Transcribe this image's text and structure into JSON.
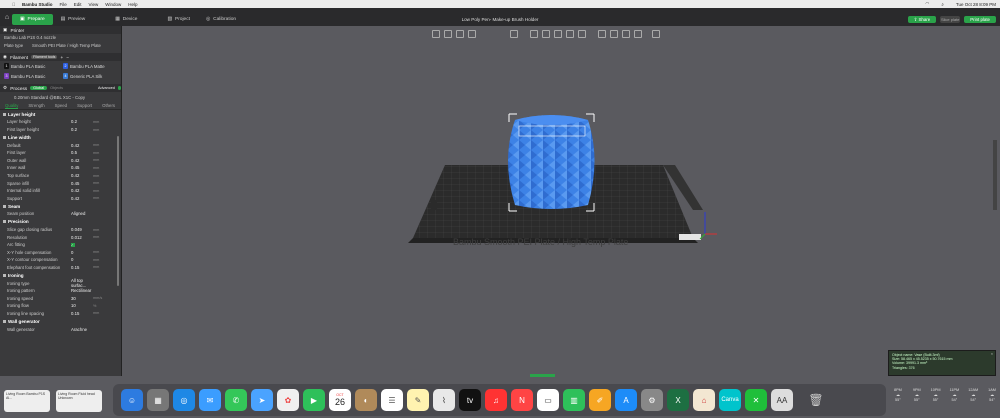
{
  "menubar": {
    "app": "Bambu Studio",
    "items": [
      "File",
      "Edit",
      "View",
      "Window",
      "Help"
    ],
    "clock": "Tue Oct 28  8:09 PM"
  },
  "toolbar": {
    "tabs": [
      "Prepare",
      "Preview",
      "Device",
      "Project",
      "Calibration"
    ],
    "title": "Low Poly Pen- Make-up Brush Holder",
    "share": "Share",
    "slice": "Slice plate",
    "print": "Print plate"
  },
  "printer": {
    "header": "Printer",
    "name": "Bambu Lab P1S 0.4 nozzle",
    "plate_label": "Plate type",
    "plate_value": "Smooth PEI Plate / High Temp Plate"
  },
  "filament": {
    "header": "Filament",
    "sync_label": "Filament tools",
    "items": [
      {
        "idx": "1",
        "name": "Bambu PLA Basic",
        "color": "#111111"
      },
      {
        "idx": "2",
        "name": "Bambu PLA Matte",
        "color": "#2d5fe0"
      },
      {
        "idx": "3",
        "name": "Bambu PLA Basic",
        "color": "#7b3fbf"
      },
      {
        "idx": "4",
        "name": "Generic PLA Silk",
        "color": "#3a7bd5"
      }
    ]
  },
  "process": {
    "header": "Process",
    "global": "Global",
    "objects": "Objects",
    "advanced": "Advanced",
    "preset": "0.20mm Standard @BBL X1C - Copy",
    "tabs": [
      "Quality",
      "Strength",
      "Speed",
      "Support",
      "Others"
    ]
  },
  "groups": [
    {
      "title": "Layer height",
      "rows": [
        {
          "l": "Layer height",
          "v": "0.2",
          "u": "mm"
        },
        {
          "l": "First layer height",
          "v": "0.2",
          "u": "mm"
        }
      ]
    },
    {
      "title": "Line width",
      "rows": [
        {
          "l": "Default",
          "v": "0.42",
          "u": "mm"
        },
        {
          "l": "First layer",
          "v": "0.5",
          "u": "mm"
        },
        {
          "l": "Outer wall",
          "v": "0.42",
          "u": "mm"
        },
        {
          "l": "Inner wall",
          "v": "0.45",
          "u": "mm"
        },
        {
          "l": "Top surface",
          "v": "0.42",
          "u": "mm"
        },
        {
          "l": "Sparse infill",
          "v": "0.45",
          "u": "mm"
        },
        {
          "l": "Internal solid infill",
          "v": "0.42",
          "u": "mm"
        },
        {
          "l": "Support",
          "v": "0.42",
          "u": "mm"
        }
      ]
    },
    {
      "title": "Seam",
      "rows": [
        {
          "l": "Seam position",
          "v": "Aligned",
          "u": ""
        }
      ]
    },
    {
      "title": "Precision",
      "rows": [
        {
          "l": "Slice gap closing radius",
          "v": "0.049",
          "u": "mm"
        },
        {
          "l": "Resolution",
          "v": "0.012",
          "u": "mm"
        },
        {
          "l": "Arc fitting",
          "v": "✓",
          "u": ""
        },
        {
          "l": "X-Y hole compensation",
          "v": "0",
          "u": "mm"
        },
        {
          "l": "X-Y contour compensation",
          "v": "0",
          "u": "mm"
        },
        {
          "l": "Elephant foot compensation",
          "v": "0.15",
          "u": "mm"
        }
      ]
    },
    {
      "title": "Ironing",
      "rows": [
        {
          "l": "Ironing type",
          "v": "All top surfac...",
          "u": ""
        },
        {
          "l": "Ironing pattern",
          "v": "Rectilinear",
          "u": ""
        },
        {
          "l": "Ironing speed",
          "v": "30",
          "u": "mm/s"
        },
        {
          "l": "Ironing flow",
          "v": "10",
          "u": "%"
        },
        {
          "l": "Ironing line spacing",
          "v": "0.15",
          "u": "mm"
        }
      ]
    },
    {
      "title": "Wall generator",
      "rows": [
        {
          "l": "Wall generator",
          "v": "Arachne",
          "u": ""
        }
      ]
    }
  ],
  "plate_label": "Bambu Smooth PEI Plate / High Temp Plate",
  "info": [
    "Object name: Vase (Built.3mf)",
    "Size: 58.465 x 45.5235 x 50.7615 mm",
    "Volume: 39991.3 mm³",
    "Triangles: 376"
  ],
  "dock_left": {
    "a": "Living Room Bambu P1S Al...",
    "b": "Living Room Fluid head Unknown"
  },
  "calendar": {
    "month": "OCT",
    "day": "26"
  },
  "weather": [
    {
      "t": "8PM",
      "v": "55°"
    },
    {
      "t": "9PM",
      "v": "55°"
    },
    {
      "t": "10PM",
      "v": "55°"
    },
    {
      "t": "11PM",
      "v": "54°"
    },
    {
      "t": "12AM",
      "v": "54°"
    },
    {
      "t": "1AM",
      "v": "54°"
    }
  ]
}
